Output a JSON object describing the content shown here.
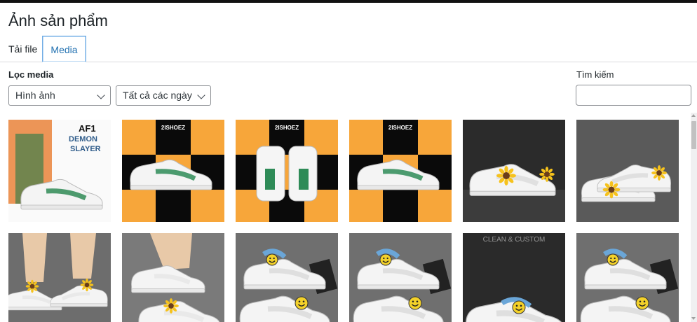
{
  "header": {
    "title": "Ảnh sản phẩm"
  },
  "tabs": [
    {
      "label": "Tải file",
      "active": false
    },
    {
      "label": "Media",
      "active": true
    }
  ],
  "filter": {
    "label": "Lọc media",
    "type_select": {
      "value": "Hình ảnh"
    },
    "date_select": {
      "value": "Tất cả các ngày"
    }
  },
  "search": {
    "label": "Tìm kiếm",
    "value": ""
  },
  "colors": {
    "accent": "#2271b1",
    "tab_border": "#72aee6",
    "orange": "#f7a63a",
    "black": "#0a0a0a"
  },
  "media_items": [
    {
      "kind": "demon-slayer-poster",
      "text_lines": [
        "AF1",
        "DEMON",
        "SLAYER"
      ]
    },
    {
      "kind": "checker-shoe",
      "brand": "2ISHOEZ"
    },
    {
      "kind": "checker-shoe-pair",
      "brand": "2ISHOEZ"
    },
    {
      "kind": "checker-shoe",
      "brand": "2ISHOEZ"
    },
    {
      "kind": "sunflower-shoe"
    },
    {
      "kind": "sunflower-shoe-pair"
    },
    {
      "kind": "worn-sunflower-shoes"
    },
    {
      "kind": "worn-sunflower-shoe"
    },
    {
      "kind": "smiley-shoes"
    },
    {
      "kind": "smiley-shoes"
    },
    {
      "kind": "smiley-shoes-dark",
      "brand": "CLEAN & CUSTOM"
    },
    {
      "kind": "smiley-shoes"
    }
  ]
}
